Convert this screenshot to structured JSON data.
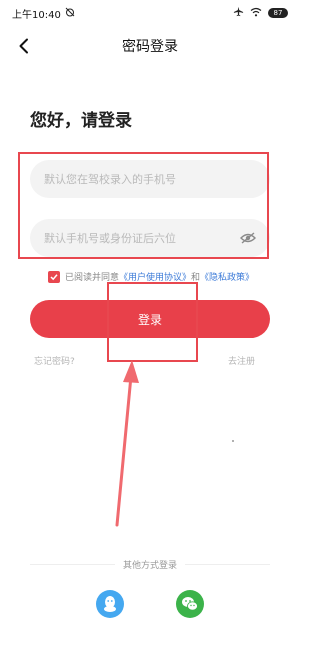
{
  "status_bar": {
    "time": "上午10:40",
    "battery": "87",
    "icons": [
      "alarm-off-icon",
      "airplane-icon",
      "wifi-icon",
      "battery-icon"
    ]
  },
  "nav": {
    "title": "密码登录",
    "back_icon": "chevron-left-icon"
  },
  "greeting": "您好，请登录",
  "form": {
    "phone_placeholder": "默认您在驾校录入的手机号",
    "password_placeholder": "默认手机号或身份证后六位",
    "eye_icon": "eye-off-icon"
  },
  "agreement": {
    "prefix": "已阅读并同意",
    "user_agreement": "《用户使用协议》",
    "and": "和",
    "privacy_policy": "《隐私政策》",
    "checked": true
  },
  "login_button": "登录",
  "forgot_password": "忘记密码?",
  "register": "去注册",
  "other_login": {
    "label": "其他方式登录",
    "methods": [
      "qq-icon",
      "wechat-icon"
    ]
  },
  "colors": {
    "accent": "#e8404a",
    "annotation": "#e8474f",
    "link": "#3d7bd8",
    "qq": "#45a8f0",
    "wechat": "#3cb34a"
  }
}
